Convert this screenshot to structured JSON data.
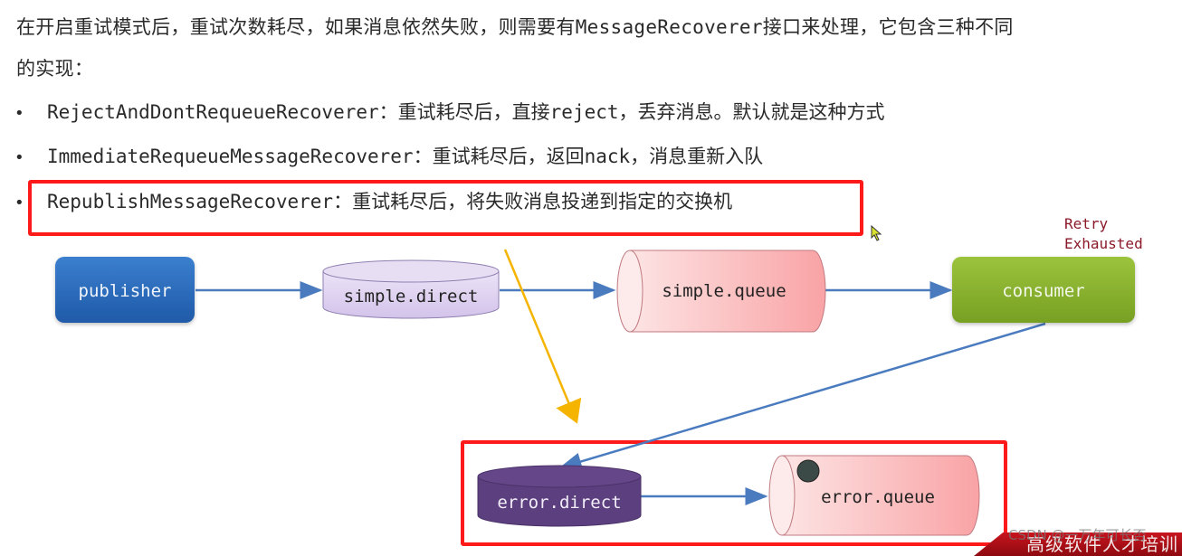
{
  "intro": {
    "line1_prefix": "在开启重试模式后，重试次数耗尽，如果消息依然失败，则需要有",
    "line1_code": "MessageRecoverer",
    "line1_suffix": "接口来处理，它包含三种不同",
    "line2": "的实现："
  },
  "bullets": [
    {
      "marker": "•",
      "name": "RejectAndDontRequeueRecoverer",
      "desc": "：重试耗尽后，直接",
      "code": "reject",
      "desc2": "，丢弃消息。默认就是这种方式",
      "highlighted": false
    },
    {
      "marker": "•",
      "name": "ImmediateRequeueMessageRecoverer",
      "desc": "：重试耗尽后，返回",
      "code": "nack",
      "desc2": "，消息重新入队",
      "highlighted": false
    },
    {
      "marker": "•",
      "name": "RepublishMessageRecoverer",
      "desc": "：重试耗尽后，将失败消息投递到指定的交换机",
      "code": "",
      "desc2": "",
      "highlighted": true
    }
  ],
  "diagram": {
    "nodes": {
      "publisher": {
        "label": "publisher",
        "kind": "process",
        "color": "#2f6fc0"
      },
      "simple_direct": {
        "label": "simple.direct",
        "kind": "exchange",
        "color": "#dccff0"
      },
      "simple_queue": {
        "label": "simple.queue",
        "kind": "queue",
        "color": "#f9a9aa"
      },
      "consumer": {
        "label": "consumer",
        "kind": "process",
        "color": "#86ad2c"
      },
      "error_direct": {
        "label": "error.direct",
        "kind": "exchange",
        "color": "#5b3f7e"
      },
      "error_queue": {
        "label": "error.queue",
        "kind": "queue",
        "color": "#f9a9aa"
      }
    },
    "edges": [
      {
        "from": "publisher",
        "to": "simple_direct"
      },
      {
        "from": "simple_direct",
        "to": "simple_queue"
      },
      {
        "from": "simple_queue",
        "to": "consumer"
      },
      {
        "from": "consumer",
        "to": "error_direct"
      },
      {
        "from": "error_direct",
        "to": "error_queue"
      }
    ],
    "annotation": {
      "line1": "Retry",
      "line2": "Exhausted",
      "color": "#8b1a2a"
    },
    "pointer_arrow_color": "#f5b400",
    "highlight_color": "#ff1a1a",
    "edge_color": "#4a7bbf"
  },
  "watermark": {
    "csdn": "CSDN @一万年可长否",
    "banner": "高级软件人才培训"
  }
}
